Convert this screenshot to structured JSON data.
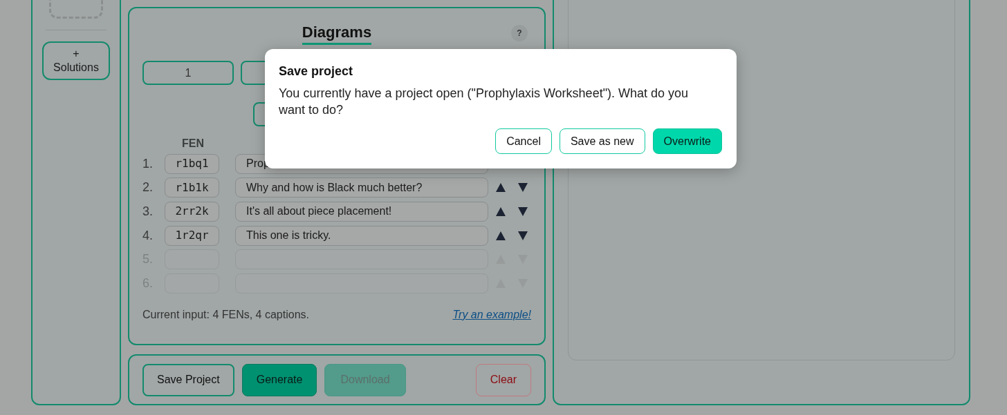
{
  "sidebar": {
    "solutions_button": {
      "plus": "+",
      "label": "Solutions"
    }
  },
  "diagrams": {
    "title": "Diagrams",
    "help": "?",
    "selector_buttons": [
      {
        "kind": "labeled",
        "label": "1"
      },
      {
        "kind": "covered"
      },
      {
        "kind": "covered_low"
      }
    ],
    "fen_header": "FEN",
    "rows": [
      {
        "number": "1.",
        "fen": "r1bq1",
        "caption": "Prop",
        "enabled": true,
        "arrows_shown": false
      },
      {
        "number": "2.",
        "fen": "r1b1k",
        "caption": "Why and how is Black much better?",
        "enabled": true,
        "arrows_shown": true
      },
      {
        "number": "3.",
        "fen": "2rr2k",
        "caption": "It's all about piece placement!",
        "enabled": true,
        "arrows_shown": true
      },
      {
        "number": "4.",
        "fen": "1r2qr",
        "caption": "This one is tricky.",
        "enabled": true,
        "arrows_shown": true
      },
      {
        "number": "5.",
        "enabled": false,
        "arrows_shown": true
      },
      {
        "number": "6.",
        "enabled": false,
        "arrows_shown": true
      }
    ],
    "status": "Current input: 4 FENs, 4 captions.",
    "example_link": "Try an example!"
  },
  "actions": [
    {
      "label": "Save Project",
      "kind": "outline"
    },
    {
      "label": "Generate",
      "kind": "primary"
    },
    {
      "label": "Download",
      "kind": "disabled"
    },
    {
      "label": "Clear",
      "kind": "danger"
    }
  ],
  "dialog": {
    "title": "Save project",
    "message": "You currently have a project open (\"Prophylaxis Worksheet\"). What do you want to do?",
    "buttons": [
      {
        "label": "Cancel",
        "kind": "outline"
      },
      {
        "label": "Save as new",
        "kind": "outline"
      },
      {
        "label": "Overwrite",
        "kind": "primary"
      }
    ]
  }
}
